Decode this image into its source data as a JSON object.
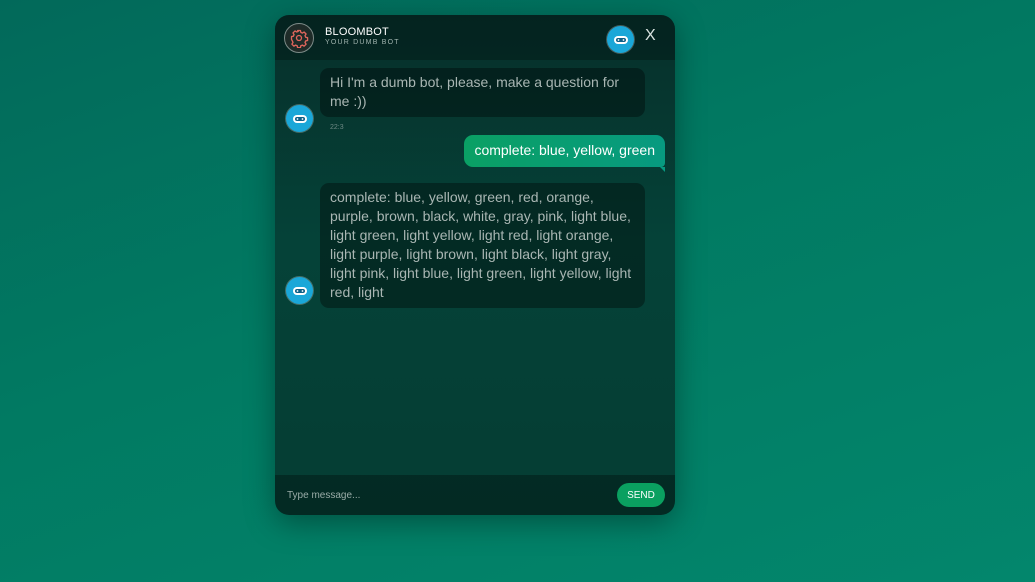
{
  "header": {
    "title": "BLOOMBOT",
    "subtitle": "YOUR DUMB BOT",
    "close_label": "X",
    "avatar_icon": "gear-icon",
    "badge_icon": "bot-icon"
  },
  "messages": [
    {
      "sender": "bot",
      "text": "Hi I'm a dumb bot, please, make a question for me :))",
      "time": "22:3"
    },
    {
      "sender": "user",
      "text": "complete: blue, yellow, green"
    },
    {
      "sender": "bot",
      "text": "complete: blue, yellow, green, red, orange, purple, brown, black, white, gray, pink, light blue, light green, light yellow, light red, light orange, light purple, light brown, light black, light gray, light pink, light blue, light green, light yellow, light red, light"
    }
  ],
  "composer": {
    "placeholder": "Type message...",
    "send_label": "SEND"
  },
  "colors": {
    "background": "#017a62",
    "accent": "#0aa060",
    "bot_badge": "#1aa7d8"
  }
}
